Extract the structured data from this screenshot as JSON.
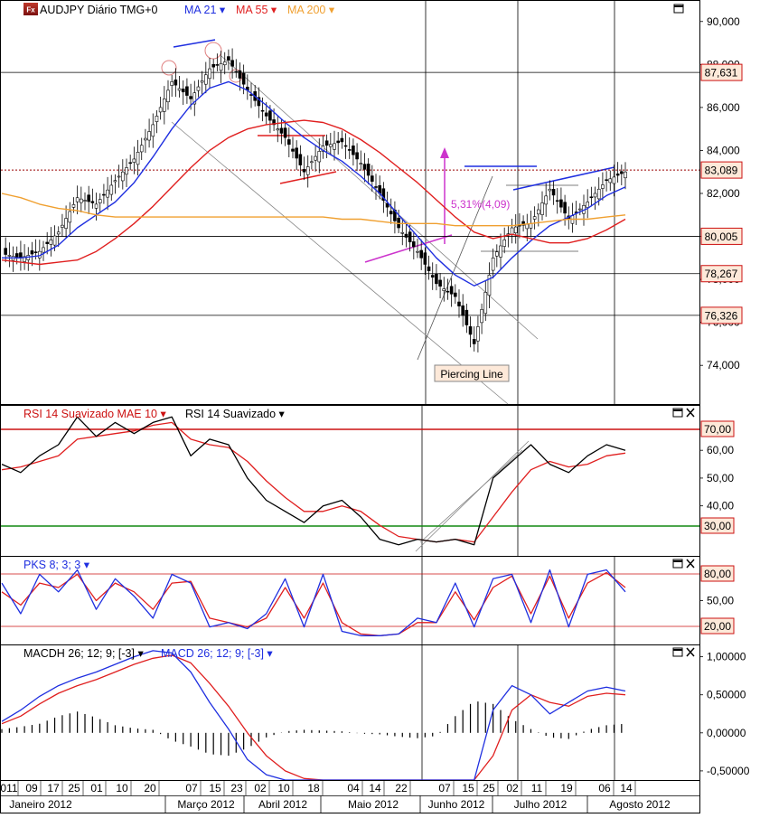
{
  "main": {
    "symbol": "AUDJPY Diário TMG+0",
    "ma21_label": "MA 21",
    "ma55_label": "MA 55",
    "ma200_label": "MA 200",
    "annotation_pct": "5,31%(4,09)",
    "annotation_pattern": "Piercing Line",
    "price_boxes": [
      "87,631",
      "83,089",
      "80,005",
      "78,267",
      "76,326"
    ]
  },
  "rsi": {
    "label1": "RSI 14 Suavizado MAE 10",
    "label2": "RSI 14 Suavizado"
  },
  "stoch": {
    "label": "PKS 8; 3; 3"
  },
  "macd": {
    "label1": "MACDH 26; 12; 9; [-3]",
    "label2": "MACD 26; 12; 9; [-3]"
  },
  "x_axis": {
    "days": [
      "011",
      "09",
      "17",
      "25",
      "01",
      "10",
      "20",
      "07",
      "15",
      "23",
      "02",
      "10",
      "18",
      "04",
      "14",
      "22",
      "07",
      "15",
      "25",
      "02",
      "11",
      "19",
      "06",
      "14"
    ],
    "months": [
      "Janeiro 2012",
      "Março 2012",
      "Abril 2012",
      "Maio 2012",
      "Junho 2012",
      "Julho 2012",
      "Agosto 2012"
    ]
  },
  "colors": {
    "ma21": "#1f2fe0",
    "ma55": "#e01f1f",
    "ma200": "#f0a030",
    "rsi_signal": "#e01f1f",
    "hline_upper": "#cc1111",
    "hline_lower": "#118811",
    "annotation": "#cc33cc"
  },
  "chart_data": [
    {
      "type": "line",
      "panel": "price",
      "title": "AUDJPY Diário TMG+0",
      "y_ticks": [
        "90,000",
        "88,000",
        "86,000",
        "84,000",
        "82,000",
        "80,000",
        "78,000",
        "76,000",
        "74,000"
      ],
      "ylim": [
        72.2,
        91.0
      ],
      "x_index": [
        0,
        5,
        10,
        15,
        20,
        25,
        30,
        35,
        40,
        45,
        50,
        55,
        60,
        65,
        70,
        75,
        80,
        85,
        90,
        95,
        100,
        105,
        110,
        115,
        120,
        125,
        130,
        135,
        140,
        145,
        150,
        155,
        160,
        165
      ],
      "series": [
        {
          "name": "Close",
          "values": [
            79.2,
            79.0,
            79.3,
            80.2,
            81.8,
            81.5,
            82.6,
            83.6,
            85.2,
            87.2,
            86.4,
            87.8,
            88.2,
            86.8,
            85.6,
            84.6,
            83.0,
            84.2,
            84.4,
            83.4,
            82.0,
            80.4,
            79.3,
            77.8,
            77.2,
            75.0,
            79.0,
            80.4,
            80.6,
            82.2,
            80.8,
            81.6,
            82.6,
            83.0
          ]
        },
        {
          "name": "MA 21",
          "values": [
            79.0,
            79.0,
            79.1,
            79.6,
            80.4,
            81.0,
            81.6,
            82.5,
            83.7,
            85.0,
            86.1,
            86.9,
            87.2,
            86.8,
            86.1,
            85.3,
            84.6,
            84.0,
            83.5,
            82.8,
            82.0,
            81.0,
            80.0,
            79.0,
            78.2,
            77.7,
            78.1,
            79.0,
            79.8,
            80.5,
            80.9,
            81.3,
            81.9,
            82.3
          ]
        },
        {
          "name": "MA 55",
          "values": [
            78.9,
            78.8,
            78.7,
            78.8,
            78.9,
            79.3,
            79.9,
            80.6,
            81.4,
            82.3,
            83.2,
            84.0,
            84.6,
            85.0,
            85.2,
            85.3,
            85.4,
            85.3,
            85.0,
            84.5,
            83.9,
            83.2,
            82.5,
            81.7,
            80.9,
            80.2,
            79.9,
            80.1,
            79.9,
            79.7,
            79.7,
            79.9,
            80.3,
            80.8
          ]
        },
        {
          "name": "MA 200",
          "values": [
            82.0,
            81.8,
            81.5,
            81.3,
            81.2,
            81.0,
            80.9,
            80.9,
            80.9,
            80.9,
            80.9,
            80.9,
            80.9,
            80.9,
            80.9,
            80.9,
            80.9,
            80.9,
            80.8,
            80.8,
            80.7,
            80.6,
            80.6,
            80.6,
            80.5,
            80.5,
            80.5,
            80.5,
            80.6,
            80.7,
            80.8,
            80.8,
            80.9,
            81.0
          ]
        }
      ],
      "levels": [
        87.631,
        83.089,
        80.005,
        78.267,
        76.326
      ],
      "annotations": [
        "5,31%(4,09)",
        "Piercing Line"
      ]
    },
    {
      "type": "line",
      "panel": "rsi",
      "title": "RSI 14 Suavizado",
      "y_ticks": [
        "70,00",
        "60,00",
        "50,00",
        "40,00",
        "30,00"
      ],
      "ylim": [
        22,
        76
      ],
      "x_index": [
        0,
        5,
        10,
        15,
        20,
        25,
        30,
        35,
        40,
        45,
        50,
        55,
        60,
        65,
        70,
        75,
        80,
        85,
        90,
        95,
        100,
        105,
        110,
        115,
        120,
        125,
        130,
        135,
        140,
        145,
        150,
        155,
        160,
        165
      ],
      "series": [
        {
          "name": "RSI 14 Suavizado",
          "values": [
            55,
            52,
            58,
            62,
            72,
            65,
            70,
            66,
            70,
            72,
            58,
            64,
            62,
            50,
            42,
            38,
            34,
            40,
            42,
            36,
            28,
            26,
            28,
            27,
            28,
            26,
            50,
            56,
            62,
            55,
            52,
            58,
            62,
            60
          ]
        },
        {
          "name": "RSI 14 Suavizado MAE 10",
          "values": [
            53,
            54,
            56,
            58,
            64,
            65,
            66,
            67,
            69,
            70,
            64,
            62,
            61,
            56,
            49,
            43,
            38,
            38,
            40,
            38,
            33,
            29,
            28,
            27,
            28,
            27,
            36,
            45,
            53,
            56,
            54,
            55,
            58,
            59
          ]
        }
      ],
      "levels": [
        70,
        30
      ]
    },
    {
      "type": "line",
      "panel": "stochastic",
      "title": "PKS 8; 3; 3",
      "y_ticks": [
        "80,00",
        "50,00",
        "20,00"
      ],
      "ylim": [
        0,
        100
      ],
      "x_index": [
        0,
        5,
        10,
        15,
        20,
        25,
        30,
        35,
        40,
        45,
        50,
        55,
        60,
        65,
        70,
        75,
        80,
        85,
        90,
        95,
        100,
        105,
        110,
        115,
        120,
        125,
        130,
        135,
        140,
        145,
        150,
        155,
        160,
        165
      ],
      "series": [
        {
          "name": "%K",
          "values": [
            70,
            35,
            80,
            60,
            85,
            40,
            75,
            55,
            30,
            80,
            70,
            20,
            25,
            18,
            35,
            75,
            20,
            80,
            15,
            10,
            10,
            12,
            30,
            25,
            70,
            20,
            75,
            80,
            25,
            85,
            20,
            80,
            85,
            60
          ]
        },
        {
          "name": "%D",
          "values": [
            60,
            45,
            70,
            65,
            80,
            50,
            70,
            60,
            40,
            70,
            72,
            30,
            25,
            20,
            30,
            65,
            30,
            70,
            25,
            12,
            10,
            12,
            25,
            25,
            60,
            28,
            65,
            78,
            35,
            78,
            30,
            70,
            82,
            65
          ]
        }
      ],
      "levels": [
        80,
        20
      ]
    },
    {
      "type": "bar",
      "panel": "macd",
      "title": "MACD 26; 12; 9; [-3]",
      "y_ticks": [
        "1,00000",
        "0,50000",
        "0,00000",
        "-0,50000"
      ],
      "ylim": [
        -0.62,
        1.15
      ],
      "x_index": [
        0,
        5,
        10,
        15,
        20,
        25,
        30,
        35,
        40,
        45,
        50,
        55,
        60,
        65,
        70,
        75,
        80,
        85,
        90,
        95,
        100,
        105,
        110,
        115,
        120,
        125,
        130,
        135,
        140,
        145,
        150,
        155,
        160,
        165
      ],
      "series": [
        {
          "name": "MACDH 26; 12; 9; [-3]",
          "values": [
            0.05,
            0.08,
            0.12,
            0.22,
            0.28,
            0.2,
            0.1,
            0.06,
            0.04,
            -0.1,
            -0.18,
            -0.28,
            -0.3,
            -0.2,
            -0.06,
            0.02,
            0.04,
            0.03,
            0.02,
            -0.01,
            -0.02,
            -0.05,
            -0.07,
            -0.04,
            0.22,
            0.42,
            0.38,
            0.18,
            0.05,
            -0.06,
            -0.08,
            0.04,
            0.1,
            0.12
          ]
        },
        {
          "name": "MACD 26; 12; 9; [-3]",
          "values": [
            0.15,
            0.3,
            0.48,
            0.62,
            0.72,
            0.8,
            0.9,
            1.0,
            1.08,
            1.05,
            0.8,
            0.4,
            0.05,
            -0.35,
            -0.55,
            -0.62,
            -0.62,
            -0.62,
            -0.62,
            -0.62,
            -0.62,
            -0.62,
            -0.62,
            -0.62,
            -0.62,
            -0.62,
            0.3,
            0.62,
            0.5,
            0.25,
            0.4,
            0.55,
            0.6,
            0.55
          ]
        },
        {
          "name": "Signal",
          "values": [
            0.12,
            0.22,
            0.38,
            0.52,
            0.62,
            0.7,
            0.8,
            0.9,
            0.98,
            1.02,
            0.92,
            0.65,
            0.35,
            0.0,
            -0.3,
            -0.5,
            -0.6,
            -0.62,
            -0.62,
            -0.62,
            -0.62,
            -0.62,
            -0.62,
            -0.62,
            -0.62,
            -0.62,
            -0.3,
            0.3,
            0.5,
            0.4,
            0.35,
            0.48,
            0.52,
            0.5
          ]
        }
      ]
    }
  ]
}
